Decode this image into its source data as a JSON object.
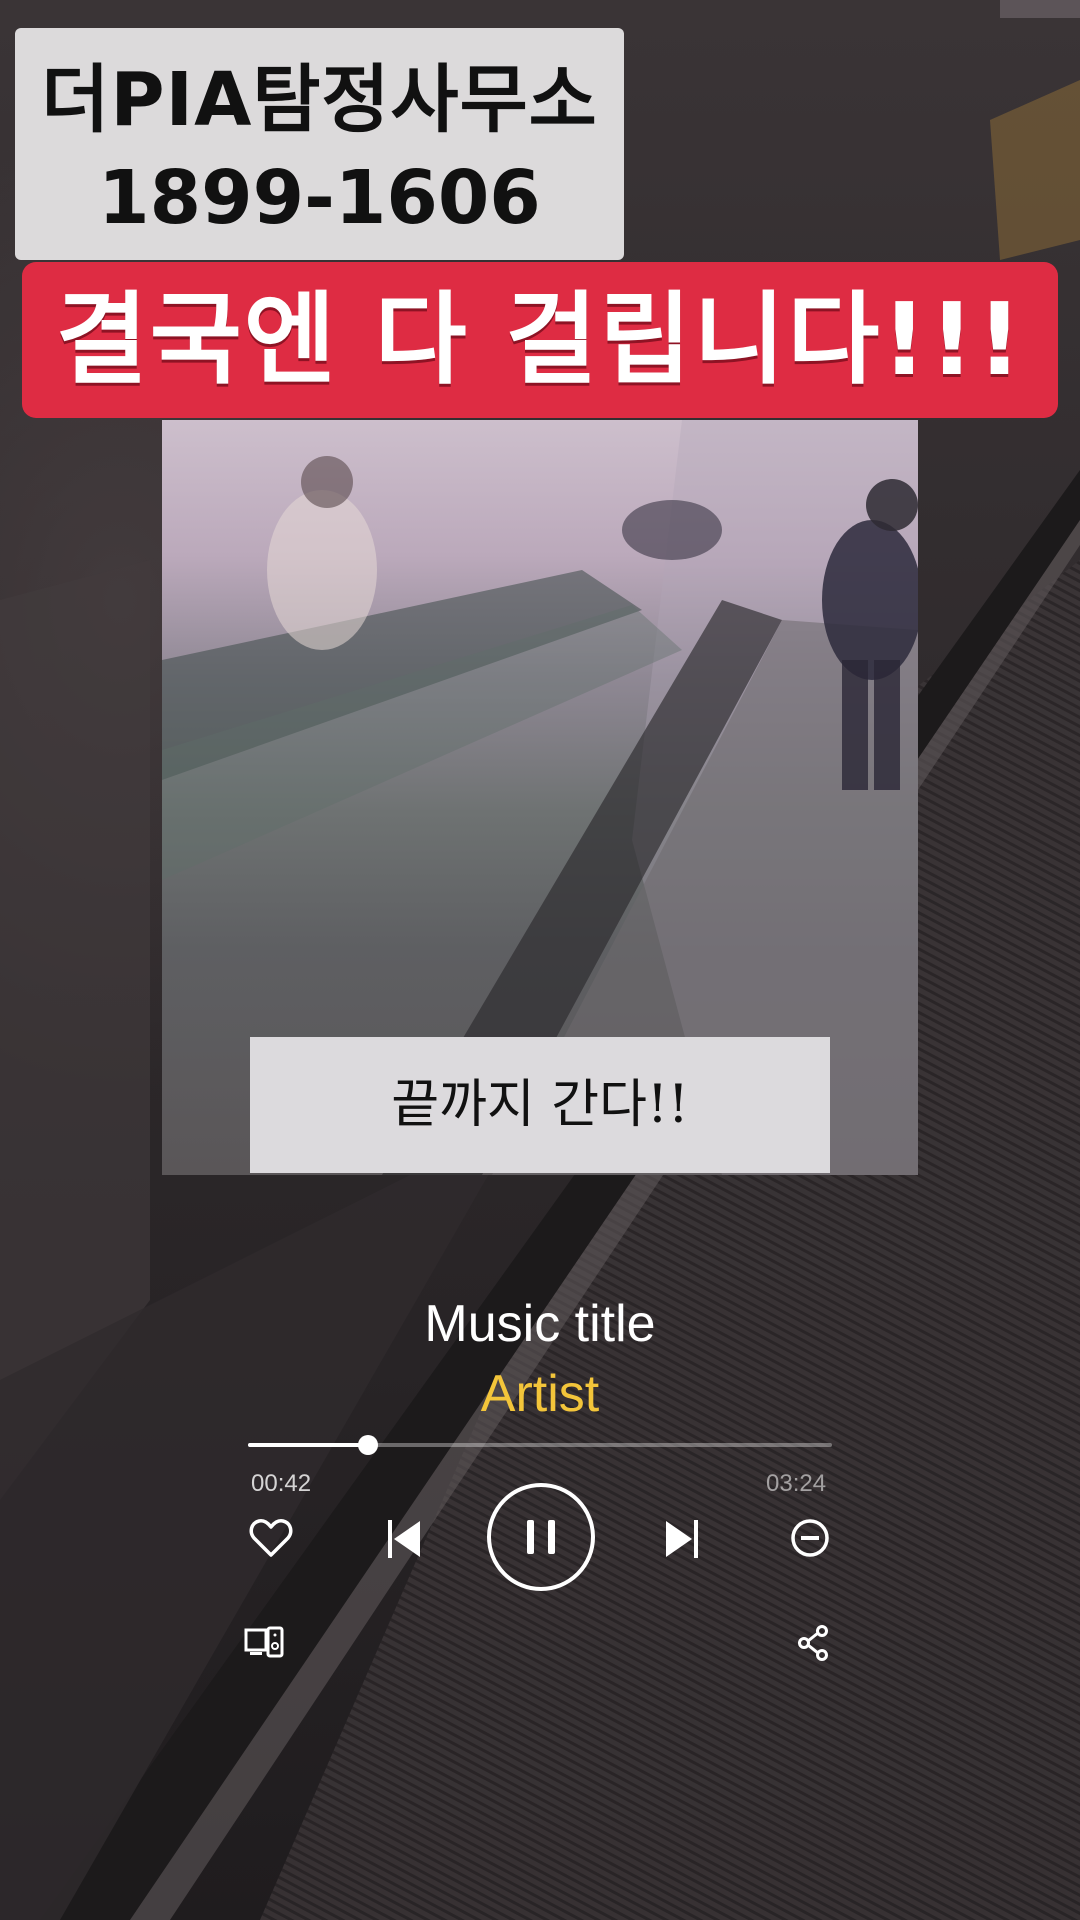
{
  "overlay": {
    "brand_name": "더PIA탐정사무소",
    "brand_phone": "1899-1606",
    "headline": "결국엔 다 걸립니다!!!",
    "caption": "끝까지 간다!!"
  },
  "player": {
    "title": "Music title",
    "artist": "Artist",
    "current_time": "00:42",
    "total_time": "03:24",
    "progress": 0.205,
    "state": "playing"
  },
  "icons": {
    "like": "heart-icon",
    "previous": "skip-previous-icon",
    "play_pause": "pause-icon",
    "next": "skip-next-icon",
    "remove": "minus-circle-icon",
    "device": "speaker-device-icon",
    "share": "share-icon"
  },
  "colors": {
    "headline_bg": "#de2c43",
    "artist": "#f3c53a",
    "overlay_box": "#dcdadb"
  }
}
